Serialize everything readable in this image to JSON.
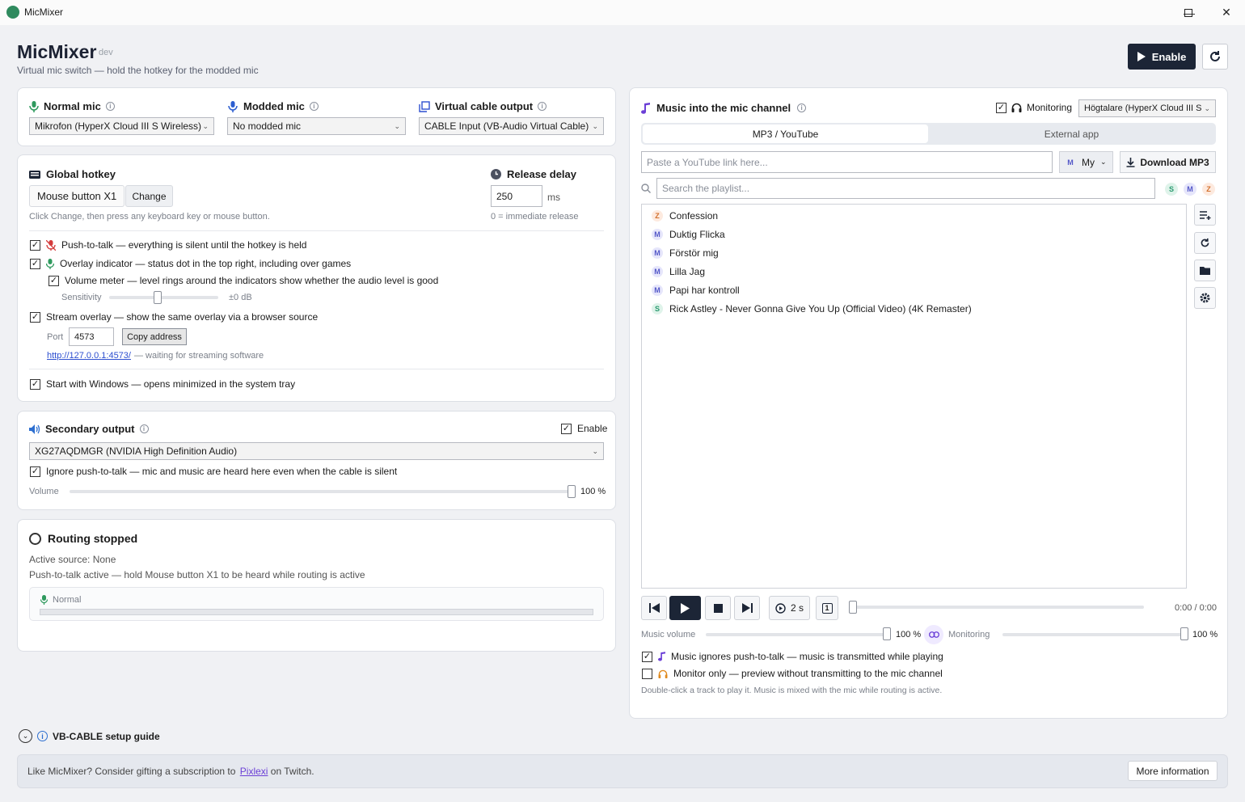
{
  "window": {
    "title": "MicMixer"
  },
  "header": {
    "title": "MicMixer",
    "badge": "dev",
    "subtitle": "Virtual mic switch — hold the hotkey for the modded mic",
    "enable_label": "Enable"
  },
  "devices": {
    "normal_label": "Normal mic",
    "normal_value": "Mikrofon (HyperX Cloud III S Wireless)",
    "modded_label": "Modded mic",
    "modded_value": "No modded mic",
    "cable_label": "Virtual cable output",
    "cable_value": "CABLE Input (VB-Audio Virtual Cable)"
  },
  "hotkey": {
    "title": "Global hotkey",
    "value": "Mouse button X1",
    "change_label": "Change",
    "hint": "Click Change, then press any keyboard key or mouse button.",
    "release_title": "Release delay",
    "release_value": "250",
    "release_unit": "ms",
    "release_hint": "0 = immediate release"
  },
  "options": {
    "ptt": "Push-to-talk — everything is silent until the hotkey is held",
    "overlay": "Overlay indicator — status dot in the top right, including over games",
    "meter": "Volume meter — level rings around the indicators show whether the audio level is good",
    "sensitivity_label": "Sensitivity",
    "sensitivity_value": "±0 dB",
    "stream": "Stream overlay — show the same overlay via a browser source",
    "port_label": "Port",
    "port_value": "4573",
    "copy_label": "Copy address",
    "url": "http://127.0.0.1:4573/",
    "url_status": "— waiting for streaming software",
    "startup": "Start with Windows — opens minimized in the system tray"
  },
  "secondary": {
    "title": "Secondary output",
    "enable_label": "Enable",
    "device": "XG27AQDMGR (NVIDIA High Definition Audio)",
    "ignore_ptt": "Ignore push-to-talk — mic and music are heard here even when the cable is silent",
    "volume_label": "Volume",
    "volume_value": "100 %",
    "volume_level": 1.0
  },
  "routing": {
    "title": "Routing stopped",
    "active_source": "Active source: None",
    "ptt_status": "Push-to-talk active — hold Mouse button X1 to be heard while routing is active",
    "meter_label": "Normal"
  },
  "music": {
    "title": "Music into the mic channel",
    "monitoring_label": "Monitoring",
    "monitor_device": "Högtalare (HyperX Cloud III S",
    "tabs": [
      "MP3 / YouTube",
      "External app"
    ],
    "youtube_placeholder": "Paste a YouTube link here...",
    "folder_badge": "M",
    "folder_label": "My",
    "download_label": "Download MP3",
    "search_placeholder": "Search the playlist...",
    "filters": [
      "S",
      "M",
      "Z"
    ],
    "tracks": [
      {
        "badge": "Z",
        "title": "Confession"
      },
      {
        "badge": "M",
        "title": "Duktig Flicka"
      },
      {
        "badge": "M",
        "title": "Förstör mig"
      },
      {
        "badge": "M",
        "title": "Lilla Jag"
      },
      {
        "badge": "M",
        "title": "Papi har kontroll"
      },
      {
        "badge": "S",
        "title": "Rick Astley - Never Gonna Give You Up (Official Video) (4K Remaster)"
      }
    ],
    "delay_label": "2 s",
    "repeat_label": "1",
    "time": "0:00 / 0:00",
    "music_volume_label": "Music volume",
    "music_volume_value": "100 %",
    "music_volume_level": 1.0,
    "monitor_label": "Monitoring",
    "monitor_volume_value": "100 %",
    "monitor_volume_level": 1.0,
    "ignore_ptt": "Music ignores push-to-talk — music is transmitted while playing",
    "monitor_only": "Monitor only — preview without transmitting to the mic channel",
    "hint": "Double-click a track to play it. Music is mixed with the mic while routing is active."
  },
  "guide": {
    "label": "VB-CABLE setup guide"
  },
  "footer": {
    "text_before": "Like MicMixer? Consider gifting a subscription to ",
    "link": "Pixlexi",
    "text_after": " on Twitch.",
    "more_label": "More information"
  },
  "colors": {
    "accent_dark": "#1c2536",
    "mic_green": "#2f9a5e",
    "music_purple": "#6b3fd6",
    "link": "#2d4fd0"
  }
}
